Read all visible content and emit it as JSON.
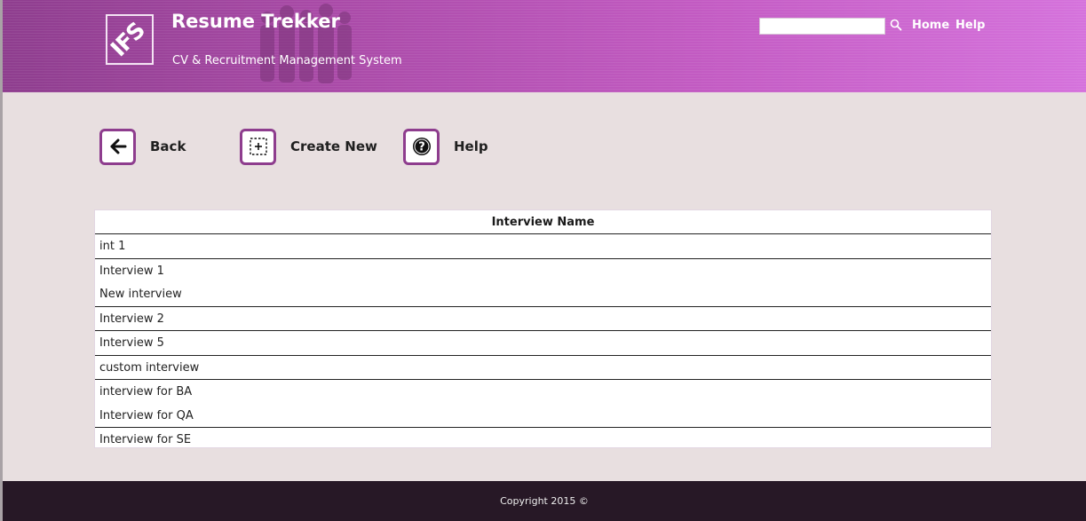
{
  "header": {
    "logo_text": "IFS",
    "title": "Resume Trekker",
    "subtitle": "CV & Recruitment Management System",
    "search": {
      "placeholder": "",
      "value": ""
    },
    "nav": {
      "home": "Home",
      "help": "Help"
    }
  },
  "toolbar": {
    "back": "Back",
    "create_new": "Create New",
    "help": "Help"
  },
  "table": {
    "header": "Interview Name",
    "groups": [
      [
        "int 1"
      ],
      [
        "Interview 1",
        "New interview"
      ],
      [
        "Interview 2"
      ],
      [
        "Interview 5"
      ],
      [
        "custom interview"
      ],
      [
        "interview for BA",
        "Interview for QA"
      ],
      [
        "Interview for SE"
      ]
    ]
  },
  "footer": {
    "copyright": "Copyright 2015 ©"
  },
  "colors": {
    "accent": "#8e3d8e",
    "header_start": "#8e3d8e",
    "header_end": "#d572dc",
    "background": "#e8dfe0",
    "footer": "#271826"
  }
}
